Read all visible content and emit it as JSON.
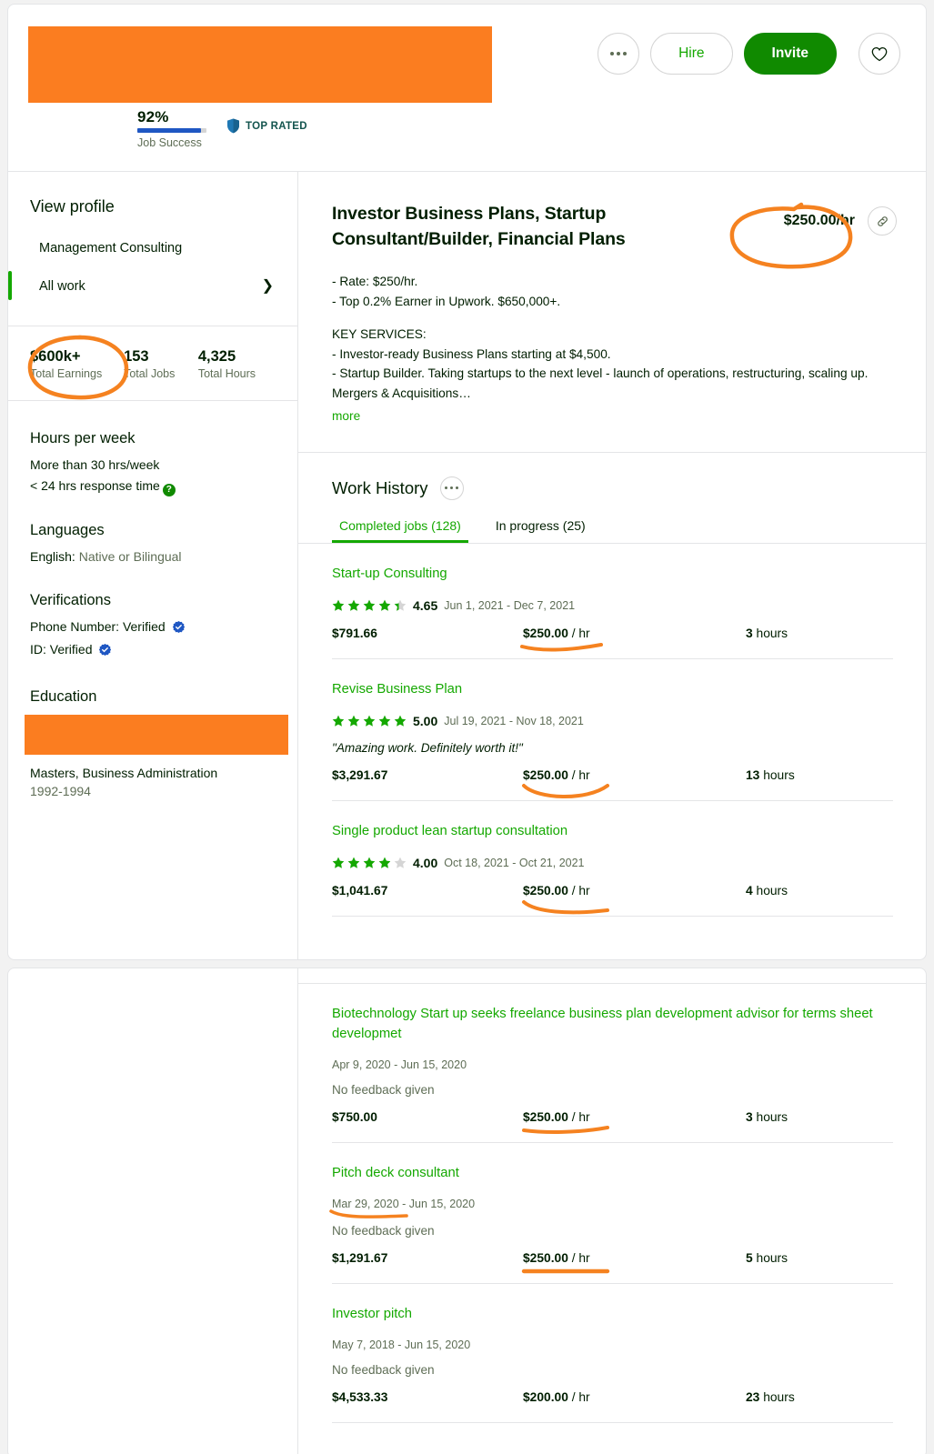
{
  "colors": {
    "accent_green": "#14a800",
    "invite_green": "#108a00",
    "annotation_orange": "#f58220",
    "redaction_orange": "#fb7d20",
    "verified_blue": "#1f57c3",
    "muted_text": "#5e6d55"
  },
  "header": {
    "job_success_percent": "92%",
    "job_success_label": "Job Success",
    "job_success_value": 92,
    "top_rated_label": "TOP RATED",
    "top_rated_icon": "shield-icon",
    "more_icon": "ellipsis-icon",
    "hire_label": "Hire",
    "invite_label": "Invite",
    "favorite_icon": "heart-icon"
  },
  "sidebar": {
    "view_profile": "View profile",
    "nav_items": [
      {
        "label": "Management Consulting",
        "active": false
      },
      {
        "label": "All work",
        "active": true,
        "chevron": "chevron-right-icon"
      }
    ],
    "stats": [
      {
        "value": "$600k+",
        "label": "Total Earnings"
      },
      {
        "value": "153",
        "label": "Total Jobs"
      },
      {
        "value": "4,325",
        "label": "Total Hours"
      }
    ],
    "hours_per_week": {
      "title": "Hours per week",
      "availability": "More than 30 hrs/week",
      "response_time": "< 24 hrs response time",
      "help_icon": "question-mark-icon"
    },
    "languages": {
      "title": "Languages",
      "entries": [
        {
          "name": "English:",
          "level": "Native or Bilingual"
        }
      ]
    },
    "verifications": {
      "title": "Verifications",
      "entries": [
        {
          "name": "Phone Number:",
          "status": "Verified",
          "icon": "verified-check-icon"
        },
        {
          "name": "ID:",
          "status": "Verified",
          "icon": "verified-check-icon"
        }
      ]
    },
    "education": {
      "title": "Education",
      "school_redacted": true,
      "degree": "Masters, Business Administration",
      "years": "1992-1994"
    }
  },
  "profile": {
    "title": "Investor Business Plans, Startup Consultant/Builder, Financial Plans",
    "rate": "$250.00/hr",
    "link_icon": "link-icon",
    "description_lines": [
      "- Rate: $250/hr.",
      "- Top 0.2% Earner in Upwork. $650,000+.",
      "",
      "KEY SERVICES:",
      "- Investor-ready Business Plans starting at $4,500.",
      "- Startup Builder. Taking startups to the next level - launch of operations, restructuring, scaling up. Mergers & Acquisitions…"
    ],
    "more_label": "more"
  },
  "work_history": {
    "title": "Work History",
    "menu_icon": "ellipsis-icon",
    "tabs": [
      {
        "label": "Completed jobs (128)",
        "active": true
      },
      {
        "label": "In progress (25)",
        "active": false
      }
    ],
    "jobs_top": [
      {
        "title": "Start-up Consulting",
        "rating": "4.65",
        "stars": 4.65,
        "dates": "Jun 1, 2021 - Dec 7, 2021",
        "feedback": "",
        "earnings": "$791.66",
        "rate": "$250.00",
        "rate_unit": "/ hr",
        "hours": "3",
        "hours_unit": "hours",
        "annotated_rate": true
      },
      {
        "title": "Revise Business Plan",
        "rating": "5.00",
        "stars": 5,
        "dates": "Jul 19, 2021 - Nov 18, 2021",
        "feedback": "\"Amazing work. Definitely worth it!\"",
        "earnings": "$3,291.67",
        "rate": "$250.00",
        "rate_unit": "/ hr",
        "hours": "13",
        "hours_unit": "hours",
        "annotated_rate": true
      },
      {
        "title": "Single product lean startup consultation",
        "rating": "4.00",
        "stars": 4,
        "dates": "Oct 18, 2021 - Oct 21, 2021",
        "feedback": "",
        "earnings": "$1,041.67",
        "rate": "$250.00",
        "rate_unit": "/ hr",
        "hours": "4",
        "hours_unit": "hours",
        "annotated_rate": true
      }
    ],
    "jobs_bottom": [
      {
        "title": "Biotechnology Start up seeks freelance business plan development advisor for terms sheet developmet",
        "rating": "",
        "stars": 0,
        "dates": "Apr 9, 2020 - Jun 15, 2020",
        "feedback": "No feedback given",
        "earnings": "$750.00",
        "rate": "$250.00",
        "rate_unit": "/ hr",
        "hours": "3",
        "hours_unit": "hours",
        "annotated_rate": true,
        "annotated_dates": false
      },
      {
        "title": "Pitch deck consultant",
        "rating": "",
        "stars": 0,
        "dates": "Mar 29, 2020 - Jun 15, 2020",
        "feedback": "No feedback given",
        "earnings": "$1,291.67",
        "rate": "$250.00",
        "rate_unit": "/ hr",
        "hours": "5",
        "hours_unit": "hours",
        "annotated_rate": true,
        "annotated_dates": true
      },
      {
        "title": "Investor pitch",
        "rating": "",
        "stars": 0,
        "dates": "May 7, 2018 - Jun 15, 2020",
        "feedback": "No feedback given",
        "earnings": "$4,533.33",
        "rate": "$200.00",
        "rate_unit": "/ hr",
        "hours": "23",
        "hours_unit": "hours",
        "annotated_rate": false,
        "annotated_dates": false
      }
    ]
  },
  "annotations": [
    {
      "target": "total-earnings-stat",
      "shape": "ellipse"
    },
    {
      "target": "hourly-rate",
      "shape": "ellipse"
    },
    {
      "target": "job-rate",
      "shape": "underline"
    }
  ]
}
